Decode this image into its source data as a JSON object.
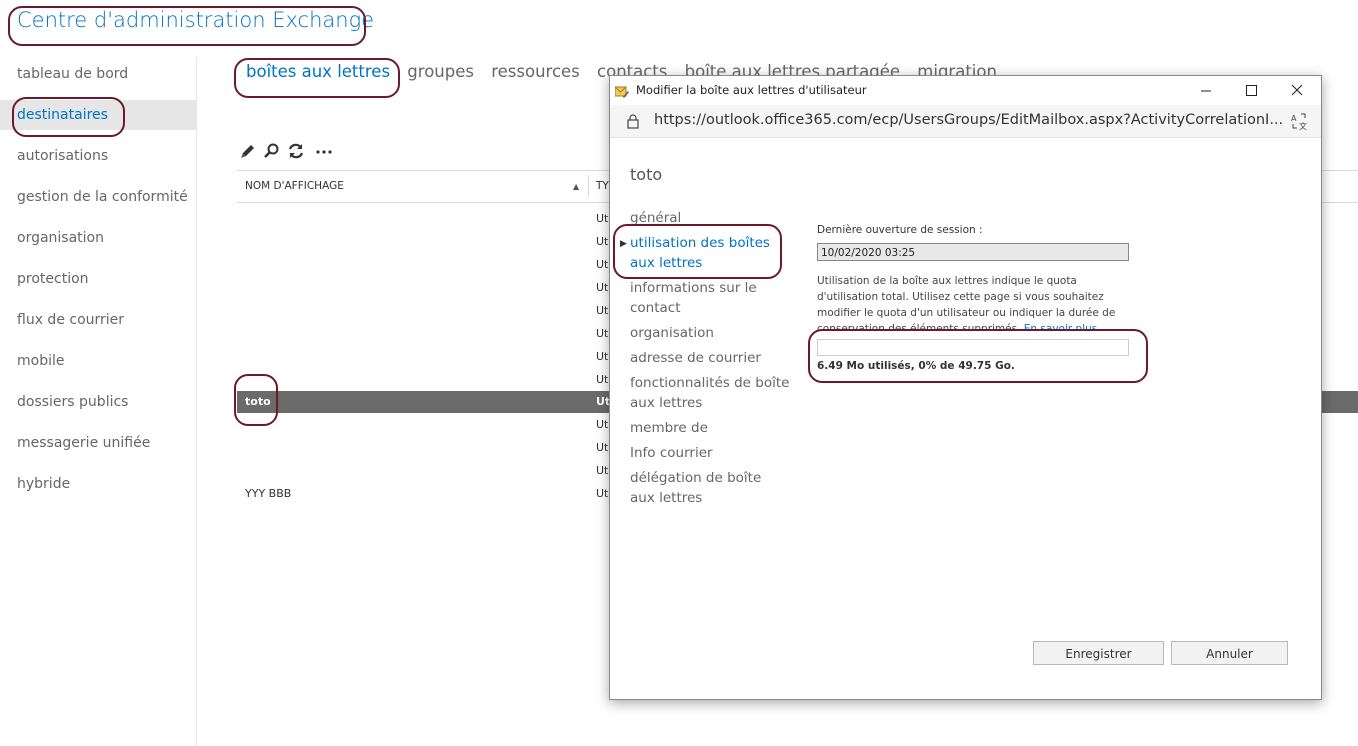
{
  "app": {
    "title": "Centre d'administration Exchange"
  },
  "leftnav": {
    "items": [
      {
        "label": "tableau de bord"
      },
      {
        "label": "destinataires",
        "active": true
      },
      {
        "label": "autorisations"
      },
      {
        "label": "gestion de la conformité"
      },
      {
        "label": "organisation"
      },
      {
        "label": "protection"
      },
      {
        "label": "flux de courrier"
      },
      {
        "label": "mobile"
      },
      {
        "label": "dossiers publics"
      },
      {
        "label": "messagerie unifiée"
      },
      {
        "label": "hybride"
      }
    ]
  },
  "tabs": [
    {
      "label": "boîtes aux lettres",
      "active": true
    },
    {
      "label": "groupes"
    },
    {
      "label": "ressources"
    },
    {
      "label": "contacts"
    },
    {
      "label": "boîte aux lettres partagée"
    },
    {
      "label": "migration"
    }
  ],
  "toolbar": {
    "icons": [
      "edit-icon",
      "search-icon",
      "refresh-icon",
      "more-icon"
    ]
  },
  "grid": {
    "columns": [
      "NOM D'AFFICHAGE",
      "TY"
    ],
    "rows": [
      {
        "name": "",
        "type": "Ut"
      },
      {
        "name": "",
        "type": "Ut"
      },
      {
        "name": "",
        "type": "Ut"
      },
      {
        "name": "",
        "type": "Ut"
      },
      {
        "name": "",
        "type": "Ut"
      },
      {
        "name": "",
        "type": "Ut"
      },
      {
        "name": "",
        "type": "Ut"
      },
      {
        "name": "",
        "type": "Ut"
      },
      {
        "name": "toto",
        "type": "Ut",
        "selected": true
      },
      {
        "name": "",
        "type": "Ut"
      },
      {
        "name": "",
        "type": "Ut"
      },
      {
        "name": "",
        "type": "Ut"
      },
      {
        "name": "YYY BBB",
        "type": "Ut"
      }
    ]
  },
  "dialog": {
    "title": "Modifier la boîte aux lettres d'utilisateur",
    "url": "https://outlook.office365.com/ecp/UsersGroups/EditMailbox.aspx?ActivityCorrelationI...",
    "mailbox_name": "toto",
    "nav": [
      {
        "label": "général"
      },
      {
        "label": "utilisation des boîtes aux lettres",
        "active": true
      },
      {
        "label": "informations sur le contact"
      },
      {
        "label": "organisation"
      },
      {
        "label": "adresse de courrier"
      },
      {
        "label": "fonctionnalités de boîte aux lettres"
      },
      {
        "label": "membre de"
      },
      {
        "label": "Info courrier"
      },
      {
        "label": "délégation de boîte aux lettres"
      }
    ],
    "last_logon_label": "Dernière ouverture de session :",
    "last_logon_value": "10/02/2020 03:25",
    "description": "Utilisation de la boîte aux lettres indique le quota d'utilisation total. Utilisez cette page si vous souhaitez modifier le quota d'un utilisateur ou indiquer la durée de conservation des éléments supprimés.",
    "learn_more": "En savoir plus",
    "usage_percent": 0,
    "usage_text": "6.49 Mo utilisés, 0% de 49.75 Go.",
    "save_label": "Enregistrer",
    "cancel_label": "Annuler"
  },
  "colors": {
    "accent": "#0072c6",
    "annotation": "#6b1a2e",
    "selected_row": "#6b6b6b"
  }
}
